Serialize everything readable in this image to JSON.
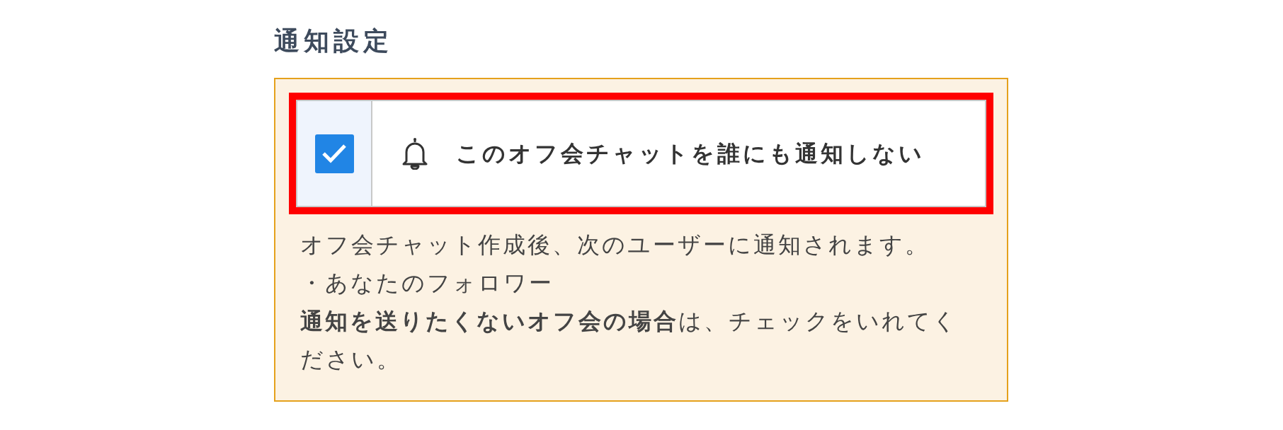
{
  "section_title": "通知設定",
  "option": {
    "label": "このオフ会チャットを誰にも通知しない",
    "checked": true,
    "highlighted": true
  },
  "description": [
    "オフ会チャット作成後、次のユーザーに通知されます。",
    "・あなたのフォロワー",
    "**通知を送りたくないオフ会の場合**は、チェックをいれてください。"
  ]
}
